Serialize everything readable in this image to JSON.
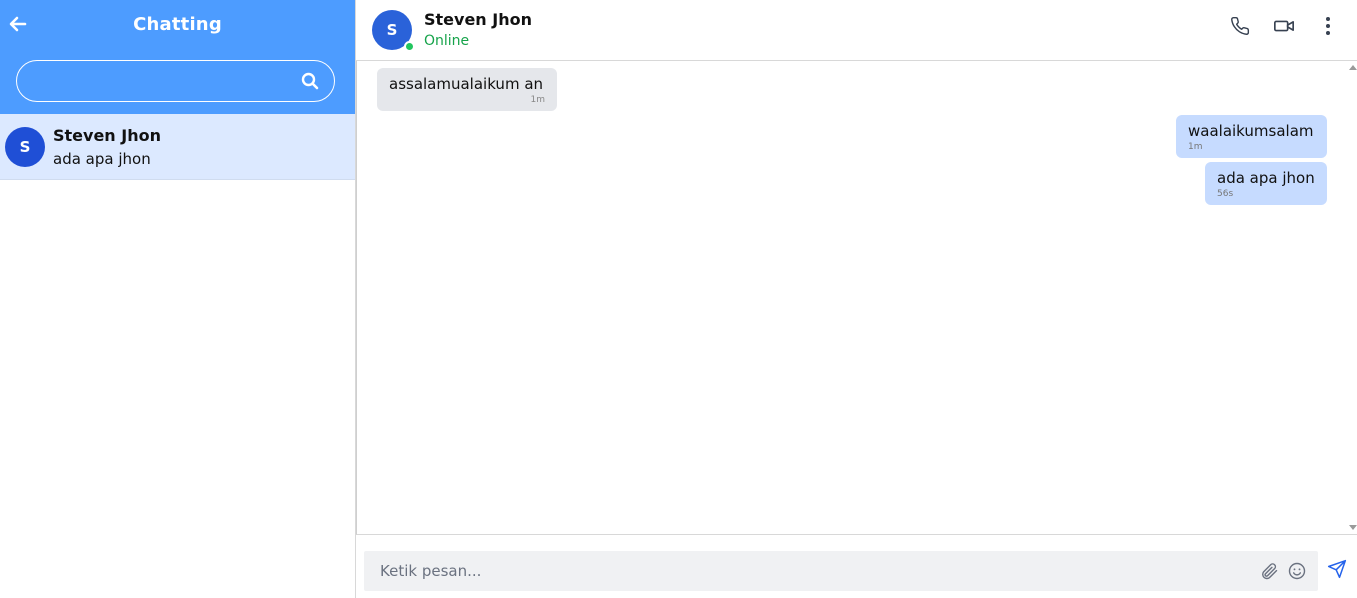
{
  "colors": {
    "accent": "#4d9cff",
    "selected_row": "#dce9ff",
    "avatar": "#1f4fd6",
    "online": "#22c55e",
    "incoming_bubble": "#e5e7eb",
    "outgoing_bubble": "#c6dbff"
  },
  "sidebar": {
    "title": "Chatting",
    "back_icon": "arrow-left-icon",
    "search": {
      "placeholder": "",
      "value": "",
      "icon": "search-icon"
    },
    "contacts": [
      {
        "initial": "S",
        "name": "Steven Jhon",
        "last_message": "ada apa jhon"
      }
    ]
  },
  "chat": {
    "contact": {
      "initial": "S",
      "name": "Steven Jhon",
      "status": "Online"
    },
    "actions": [
      "phone-icon",
      "video-icon",
      "more-vertical-icon"
    ],
    "messages": [
      {
        "direction": "incoming",
        "text": "assalamualaikum an",
        "time": "1m"
      },
      {
        "direction": "outgoing",
        "text": "waalaikumsalam",
        "time": "1m"
      },
      {
        "direction": "outgoing",
        "text": "ada apa jhon",
        "time": "56s"
      }
    ],
    "composer": {
      "placeholder": "Ketik pesan...",
      "value": "",
      "attach_icon": "paperclip-icon",
      "emoji_icon": "smile-icon",
      "send_icon": "send-icon"
    }
  }
}
